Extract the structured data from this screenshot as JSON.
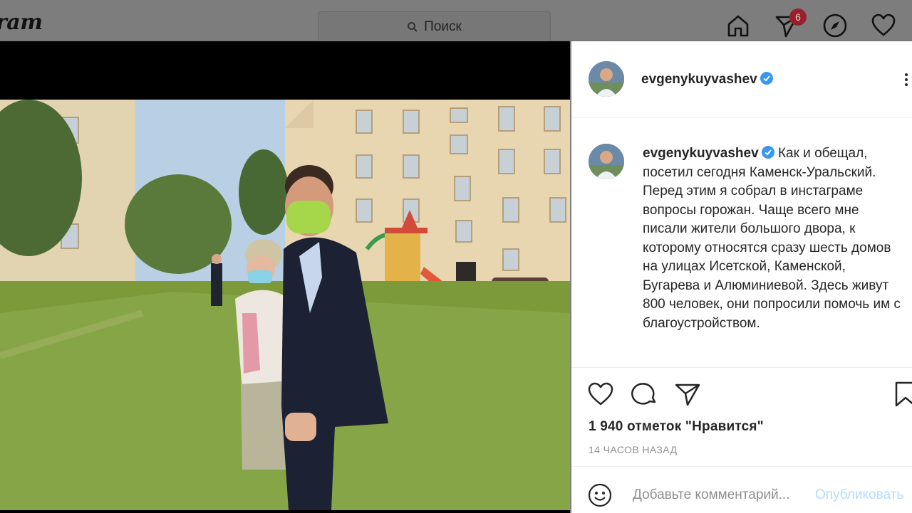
{
  "topbar": {
    "logo": "ram",
    "search_placeholder": "Поиск",
    "notifications_count": "6"
  },
  "post": {
    "username": "evgenykuyvashev",
    "caption": "Как и обещал, посетил сегодня Каменск-Уральский. Перед этим я собрал в инстаграме вопросы горожан. Чаще всего мне писали жители большого двора, к которому относятся сразу шесть домов на улицах Исетской, Каменской, Бугарева и Алюминиевой. Здесь живут 800 человек, они попросили помочь им с благоустройством.",
    "likes": "1 940 отметок \"Нравится\"",
    "time": "14 ЧАСОВ НАЗАД",
    "comment_placeholder": "Добавьте комментарий...",
    "post_button": "Опубликовать"
  },
  "icons": {
    "search": "search-icon",
    "home": "home-icon",
    "direct": "direct-icon",
    "explore": "compass-icon",
    "activity": "heart-icon",
    "verified": "verified-badge-icon",
    "more": "more-options-icon",
    "like": "heart-icon",
    "comment": "comment-icon",
    "share": "share-icon",
    "save": "bookmark-icon",
    "emoji": "emoji-icon"
  },
  "colors": {
    "verified": "#3897f0",
    "badge": "#ed4956",
    "link_disabled": "#b3dbff"
  }
}
